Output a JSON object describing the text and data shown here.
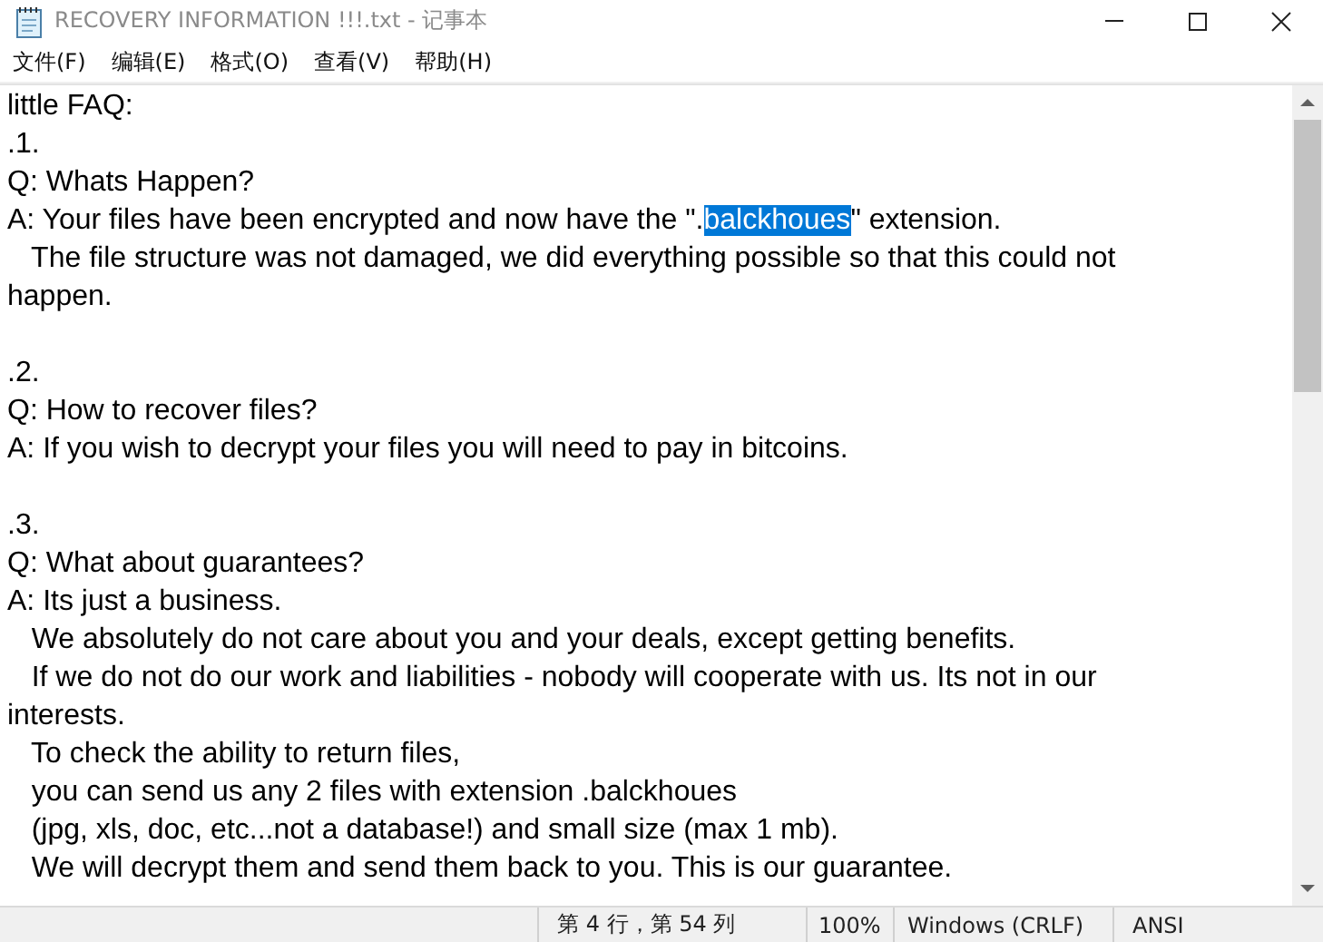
{
  "window": {
    "title": "RECOVERY INFORMATION !!!.txt - 记事本"
  },
  "menu": [
    "文件(F)",
    "编辑(E)",
    "格式(O)",
    "查看(V)",
    "帮助(H)"
  ],
  "editor": {
    "paragraphs": [
      {
        "lines": [
          {
            "parts": [
              {
                "text": "little FAQ:",
                "selected": false
              }
            ]
          },
          {
            "parts": [
              {
                "text": ".1.",
                "selected": false
              }
            ]
          },
          {
            "parts": [
              {
                "text": "Q: Whats Happen?",
                "selected": false
              }
            ]
          },
          {
            "parts": [
              {
                "text": "A: Your files have been encrypted and now have the \".",
                "selected": false
              },
              {
                "text": "balckhoues",
                "selected": true
              },
              {
                "text": "\" extension.",
                "selected": false
              }
            ]
          },
          {
            "parts": [
              {
                "text": "   The file structure was not damaged, we did everything possible so that this could not",
                "selected": false
              }
            ]
          },
          {
            "parts": [
              {
                "text": "happen.",
                "selected": false
              }
            ]
          }
        ]
      },
      {
        "lines": [
          {
            "parts": [
              {
                "text": ".2.",
                "selected": false
              }
            ]
          },
          {
            "parts": [
              {
                "text": "Q: How to recover files?",
                "selected": false
              }
            ]
          },
          {
            "parts": [
              {
                "text": "A: If you wish to decrypt your files you will need to pay in bitcoins.",
                "selected": false
              }
            ]
          }
        ]
      },
      {
        "lines": [
          {
            "parts": [
              {
                "text": ".3.",
                "selected": false
              }
            ]
          },
          {
            "parts": [
              {
                "text": "Q: What about guarantees?",
                "selected": false
              }
            ]
          },
          {
            "parts": [
              {
                "text": "A: Its just a business.",
                "selected": false
              }
            ]
          },
          {
            "parts": [
              {
                "text": "   We absolutely do not care about you and your deals, except getting benefits.",
                "selected": false
              }
            ]
          },
          {
            "parts": [
              {
                "text": "   If we do not do our work and liabilities - nobody will cooperate with us. Its not in our",
                "selected": false
              }
            ]
          },
          {
            "parts": [
              {
                "text": "interests.",
                "selected": false
              }
            ]
          },
          {
            "parts": [
              {
                "text": "   To check the ability to return files,",
                "selected": false
              }
            ]
          },
          {
            "parts": [
              {
                "text": "   you can send us any 2 files with extension .balckhoues",
                "selected": false
              }
            ]
          },
          {
            "parts": [
              {
                "text": "   (jpg, xls, doc, etc...not a database!) and small size (max 1 mb).",
                "selected": false
              }
            ]
          },
          {
            "parts": [
              {
                "text": "   We will decrypt them and send them back to you. This is our guarantee.",
                "selected": false
              }
            ]
          }
        ]
      }
    ]
  },
  "status_bar": [
    "第 4 行，第 54 列",
    "100%",
    "Windows (CRLF)",
    "ANSI"
  ]
}
